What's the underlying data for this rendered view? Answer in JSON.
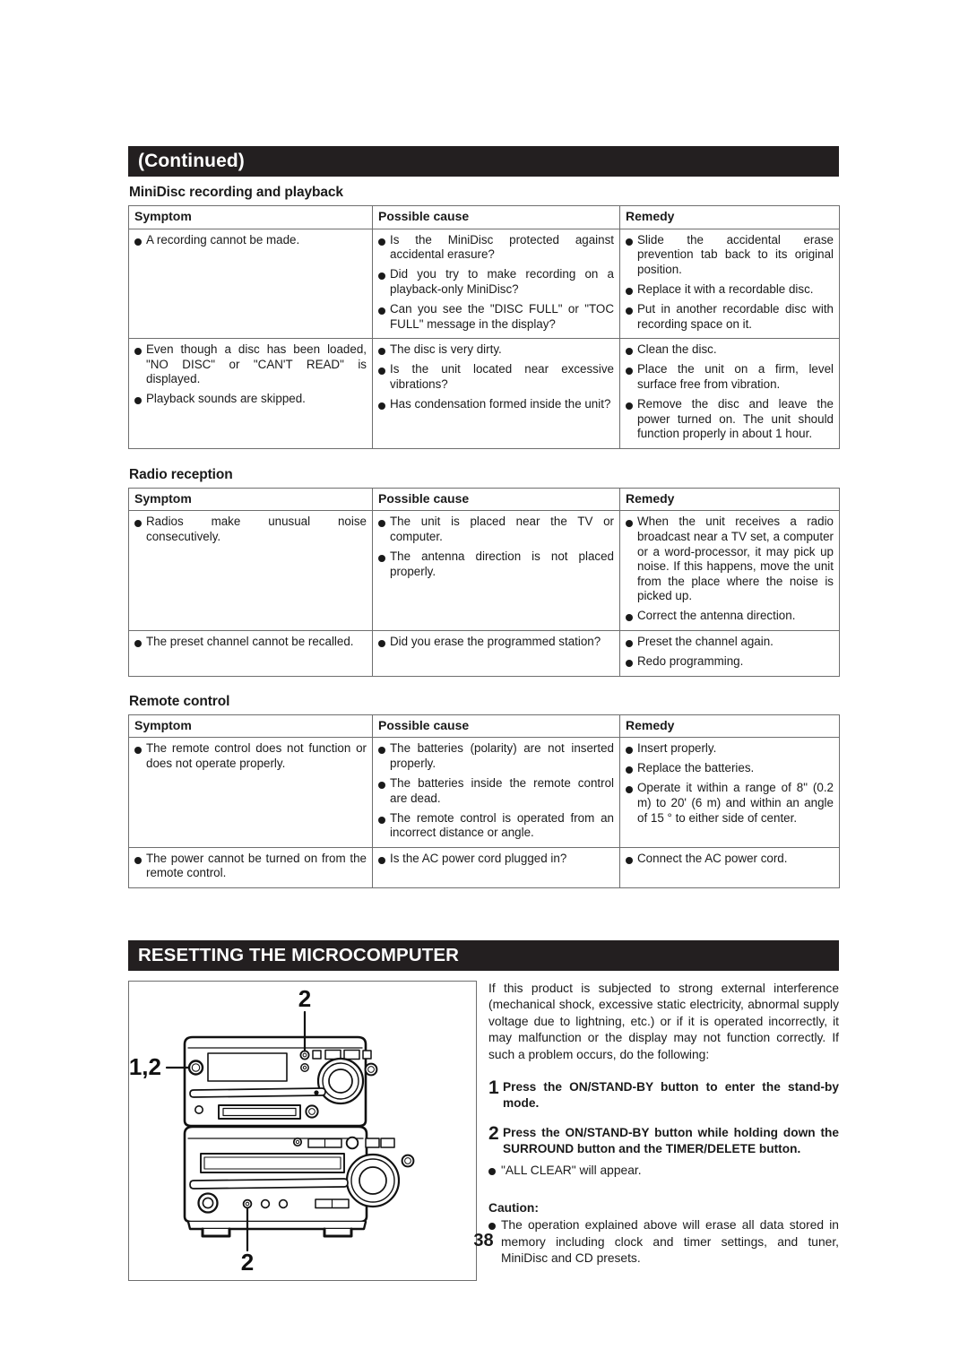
{
  "page": {
    "number": "38",
    "continued_bar": "(Continued)",
    "reset_bar": "RESETTING THE MICROCOMPUTER"
  },
  "table_headers": {
    "symptom": "Symptom",
    "possible_cause": "Possible cause",
    "remedy": "Remedy"
  },
  "sections": [
    {
      "title": "MiniDisc recording and playback",
      "rows": [
        {
          "symptom": [
            "A recording cannot be made."
          ],
          "cause": [
            "Is the MiniDisc protected against accidental erasure?",
            "Did you try to make recording on a playback-only MiniDisc?",
            "Can you see the \"DISC FULL\" or \"TOC FULL\" message in the display?"
          ],
          "remedy": [
            "Slide the accidental erase prevention tab back to its original position.",
            "Replace it with a recordable disc.",
            "Put in another recordable disc with recording space on it."
          ]
        },
        {
          "symptom": [
            "Even though a disc has been loaded, \"NO DISC\" or \"CAN'T READ\" is displayed.",
            "Playback sounds are skipped."
          ],
          "cause": [
            "The disc is very dirty.",
            "Is the unit located near excessive vibrations?",
            "Has condensation formed inside the unit?"
          ],
          "remedy": [
            "Clean the disc.",
            "Place the unit on a firm, level surface free from vibration.",
            "Remove the disc and leave the power turned on. The unit should function properly in about 1 hour."
          ]
        }
      ]
    },
    {
      "title": "Radio reception",
      "rows": [
        {
          "symptom": [
            "Radios make unusual noise consecutively."
          ],
          "cause": [
            "The unit is placed near the TV or computer.",
            "The antenna direction is not placed properly."
          ],
          "remedy": [
            "When the unit receives a radio broadcast near a TV set, a computer or a word-processor, it may pick up noise. If this happens, move the unit from the place where the noise is picked up.",
            "Correct the antenna direction."
          ]
        },
        {
          "symptom": [
            "The preset channel cannot be recalled."
          ],
          "cause": [
            "Did you erase the programmed station?"
          ],
          "remedy": [
            "Preset the channel again.",
            "Redo programming."
          ]
        }
      ]
    },
    {
      "title": "Remote control",
      "rows": [
        {
          "symptom": [
            "The remote control does not function or does not operate properly."
          ],
          "cause": [
            "The batteries (polarity) are not inserted properly.",
            "The batteries inside the remote control are dead.",
            "The remote control is operated from an incorrect distance or angle."
          ],
          "remedy": [
            "Insert properly.",
            "Replace the batteries.",
            "Operate it within a range of 8\" (0.2 m) to 20' (6 m) and within an angle of 15 ° to either side of center."
          ]
        },
        {
          "symptom": [
            "The power cannot be turned on from the remote control."
          ],
          "cause": [
            "Is the AC power cord plugged in?"
          ],
          "remedy": [
            "Connect the AC power cord."
          ]
        }
      ]
    }
  ],
  "reset": {
    "intro": "If this product is subjected to strong external interference (mechanical shock, excessive static electricity, abnormal supply voltage due to lightning, etc.) or if it is operated incorrectly, it may malfunction or the display may not function correctly. If such a problem occurs, do the following:",
    "steps": [
      {
        "num": "1",
        "text": "Press the ON/STAND-BY button to enter the stand-by mode."
      },
      {
        "num": "2",
        "text": "Press the ON/STAND-BY button while holding down the SURROUND button and the TIMER/DELETE button."
      }
    ],
    "step2_note": "\"ALL CLEAR\" will appear.",
    "caution_label": "Caution:",
    "caution_text": "The operation explained above will erase all data stored in memory including clock and timer settings, and tuner, MiniDisc and CD presets.",
    "figure": {
      "callout_left": "1,2",
      "callout_top": "2",
      "callout_bottom": "2"
    }
  }
}
